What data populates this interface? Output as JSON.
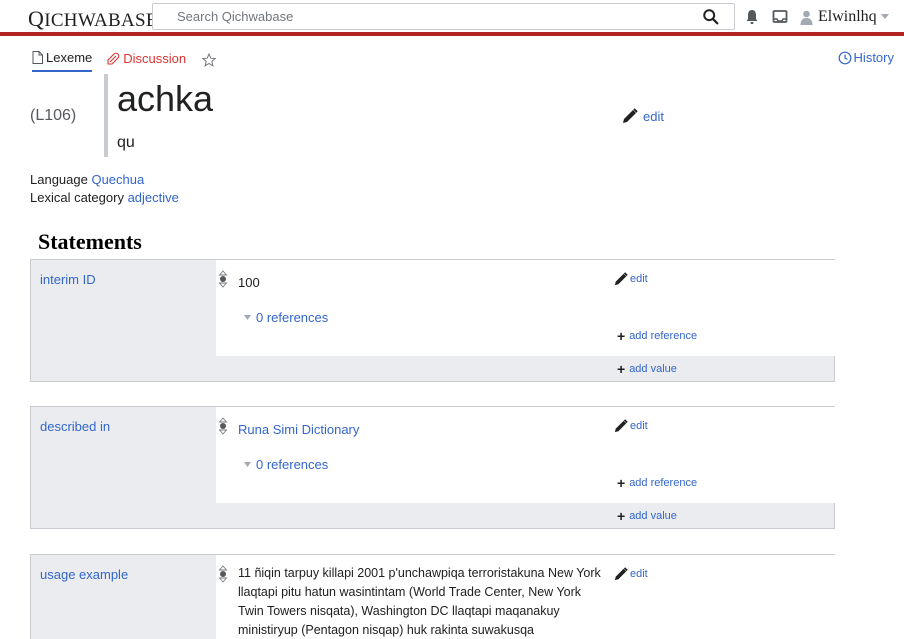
{
  "header": {
    "logo_first": "Q",
    "logo_rest": "ICHWABASE",
    "search_placeholder": "Search Qichwabase",
    "username": "Elwinlhq"
  },
  "tabs": {
    "lexeme": "Lexeme",
    "discussion": "Discussion",
    "history": "History"
  },
  "lexeme": {
    "id": "(L106)",
    "lemma": "achka",
    "lemma_language_code": "qu",
    "edit_label": "edit",
    "language_label": "Language",
    "language_value": "Quechua",
    "category_label": "Lexical category",
    "category_value": "adjective"
  },
  "statements": {
    "heading": "Statements",
    "groups": [
      {
        "property": "interim ID",
        "value": "100",
        "edit_label": "edit",
        "references": "0 references",
        "add_reference": "add reference",
        "add_value": "add value"
      },
      {
        "property": "described in",
        "value": "Runa Simi Dictionary",
        "edit_label": "edit",
        "references": "0 references",
        "add_reference": "add reference",
        "add_value": "add value"
      },
      {
        "property": "usage example",
        "value": "11 ñiqin tarpuy killapi 2001 p'unchawpiqa terroristakuna New York llaqtapi pitu hatun wasintintam (World Trade Center, New York Twin Towers nisqata), Washington DC llaqtapi maqanakuy ministiryup (Pentagon nisqap) huk rakinta suwakusqa antankakunawan",
        "edit_label": "edit"
      }
    ]
  },
  "colors": {
    "link": "#3366cc",
    "accent_bar": "#b32424",
    "discussion": "#dd3333",
    "panel_bg": "#eaecf0",
    "border": "#c8ccd1"
  }
}
